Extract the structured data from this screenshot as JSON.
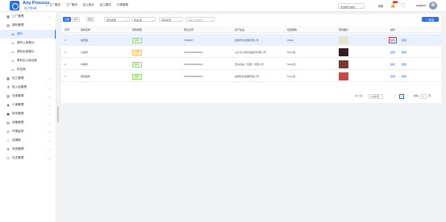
{
  "app": {
    "title": "Any Process",
    "subtitle": "加工管理系统"
  },
  "topnav": [
    {
      "label": "工厂概况",
      "icon": "home-icon"
    },
    {
      "label": "工厂概况",
      "icon": "factory-icon"
    },
    {
      "label": "加工统计",
      "icon": "stats-icon"
    },
    {
      "label": "加工概况",
      "icon": "overview-icon"
    },
    {
      "label": "订单管理",
      "icon": "order-icon"
    }
  ],
  "header": {
    "org_select": "普洛斯仓储加...",
    "link": "帮助",
    "notification_count": "99+",
    "user_name": "anyfarm"
  },
  "sidebar": [
    {
      "label": "工厂管理",
      "icon": "▦",
      "chev": "⌄"
    },
    {
      "label": "原料管理",
      "icon": "▤",
      "chev": "⌃"
    },
    {
      "label": "原料",
      "icon": "⇄",
      "sub": true,
      "active": true
    },
    {
      "label": "原料入库登记",
      "icon": "▭",
      "sub": true
    },
    {
      "label": "原料出库登记",
      "icon": "▭",
      "sub": true
    },
    {
      "label": "原料出入库台账",
      "icon": "▭",
      "sub": true
    },
    {
      "label": "供应商",
      "icon": "▭",
      "sub": true
    },
    {
      "label": "加工管理",
      "icon": "▦",
      "chev": "⌄"
    },
    {
      "label": "投入品管理",
      "icon": "⚗",
      "chev": "⌄"
    },
    {
      "label": "仓库管理",
      "icon": "▥",
      "chev": "⌄"
    },
    {
      "label": "人事管理",
      "icon": "♟",
      "chev": "⌄"
    },
    {
      "label": "财务管理",
      "icon": "▣",
      "chev": "⌄"
    },
    {
      "label": "设备管理",
      "icon": "▤",
      "chev": "⌄"
    },
    {
      "label": "环境监测",
      "icon": "◎",
      "chev": "⌄"
    },
    {
      "label": "店铺库",
      "icon": "⌂",
      "chev": "⌄"
    },
    {
      "label": "系统管理",
      "icon": "⚙",
      "chev": "⌄"
    },
    {
      "label": "日志管理",
      "icon": "◷",
      "chev": "⌄"
    }
  ],
  "toolbar": {
    "btn1": "全部",
    "btn2": "卡片",
    "btn3": "导出",
    "filter1": "原料类型",
    "filter2": "成品/批",
    "filter3": "原料来源",
    "search_placeholder": "请输入关键词",
    "add_label": "+ 新增"
  },
  "table": {
    "columns": [
      "序号",
      "原料名称",
      "原料类型",
      "登记证号",
      "生产企业",
      "包装规格",
      "原料图片",
      "操作"
    ],
    "rows": [
      {
        "no": "1",
        "name": "番茄酱",
        "type": "辅料",
        "type_color": "green",
        "cert": "7008847",
        "company": "金阙华岭发展有限公司",
        "spec": "100kg",
        "img": "#e9e3d3",
        "selected": true
      },
      {
        "no": "2",
        "name": "水晶粉",
        "type": "主料",
        "type_color": "orange",
        "cert": "20230508000903",
        "company": "山东龙大肉食品股份有限公司",
        "spec": "500g/包",
        "img": "#3b1a24"
      },
      {
        "no": "3",
        "name": "鸡精粉",
        "type": "辅料",
        "type_color": "green",
        "cert": "20230508000903",
        "company": "亚洲食品（沈阳）有限公司",
        "spec": "500g/包",
        "img": "#7a3b2e"
      },
      {
        "no": "4",
        "name": "腊肉腊味",
        "type": "辅料",
        "type_color": "green",
        "cert": "20230508000903",
        "company": "金阙华岭发展有限公司",
        "spec": "10kg/包",
        "img": "#c44a4a"
      }
    ],
    "action_edit": "编辑",
    "action_delete": "删除"
  },
  "pager": {
    "total": "共 4 条",
    "page_size": "10条/页",
    "prev": "<",
    "current": "1",
    "next": ">",
    "goto": "前往",
    "goto_value": "1",
    "page_unit": "页"
  }
}
